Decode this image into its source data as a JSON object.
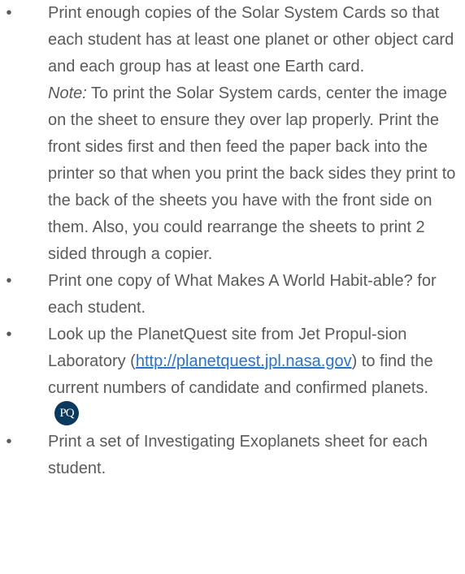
{
  "bullet_symbol": "•",
  "items": [
    {
      "text": "Print enough copies of the Solar System Cards so that each student has at least one planet or other object card and each group has at least one Earth card.",
      "note_label": "Note:",
      "note_text": " To print the Solar System cards, center the image on the sheet to ensure they over lap properly. Print the front sides first and then feed the paper back into the printer so that when you print the back sides they print to the back of the sheets you have with the front side on them. Also, you could rearrange the sheets to print 2 sided through a copier."
    },
    {
      "text": "Print one copy of What Makes A World Habit-able? for each student."
    },
    {
      "text_before": "Look up the PlanetQuest site from Jet Propul-sion Laboratory (",
      "link_text": "http://planetquest.jpl.nasa.gov",
      "text_after": ") to find the current numbers of candidate and confirmed planets.",
      "logo_text": "PQ"
    },
    {
      "text": "Print a set of Investigating Exoplanets sheet for each student."
    }
  ]
}
